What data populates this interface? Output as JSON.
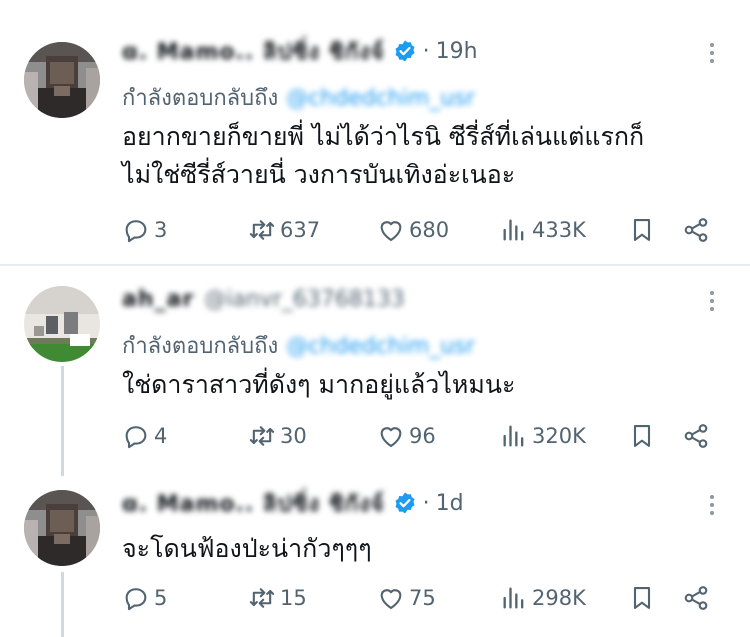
{
  "tweets": [
    {
      "name": "ɑ. Mamo.. ลิปซิ่ง ชิกังจ์",
      "handle": "",
      "time": "19h",
      "reply_label": "กำลังตอบกลับถึง",
      "reply_mention": "@chdedchim_usr",
      "lines": [
        "อยากขายก็ขายพี่ ไม่ได้ว่าไรนิ ซีรี่ส์ที่เล่นแต่แรกก็",
        "ไม่ใช่ซีรี่ส์วายนี่ วงการบันเทิงอ่ะเนอะ"
      ],
      "replies": "3",
      "retweets": "637",
      "likes": "680",
      "views": "433K",
      "verified": true
    },
    {
      "name": "ah_ar",
      "handle": "@ianvr_63768133",
      "time": "",
      "reply_label": "กำลังตอบกลับถึง",
      "reply_mention": "@chdedchim_usr",
      "lines": [
        "ใช่ดาราสาวที่ดังๆ มากอยู่แล้วไหมนะ"
      ],
      "replies": "4",
      "retweets": "30",
      "likes": "96",
      "views": "320K",
      "verified": false
    },
    {
      "name": "ɑ. Mamo.. ลิปซิ่ง ชิกังจ์",
      "handle": "",
      "time": "1d",
      "reply_label": "",
      "reply_mention": "",
      "lines": [
        "จะโดนฟ้องป่ะน่ากัวๆๆๆ"
      ],
      "replies": "5",
      "retweets": "15",
      "likes": "75",
      "views": "298K",
      "verified": true
    }
  ],
  "icons": {
    "reply": "reply-icon",
    "retweet": "retweet-icon",
    "like": "heart-icon",
    "views": "views-icon",
    "bookmark": "bookmark-icon",
    "share": "share-icon",
    "verified": "verified-badge-icon",
    "more": "more-icon"
  },
  "colors": {
    "accent": "#1d9bf0",
    "muted": "#536471",
    "text": "#0f1419"
  }
}
